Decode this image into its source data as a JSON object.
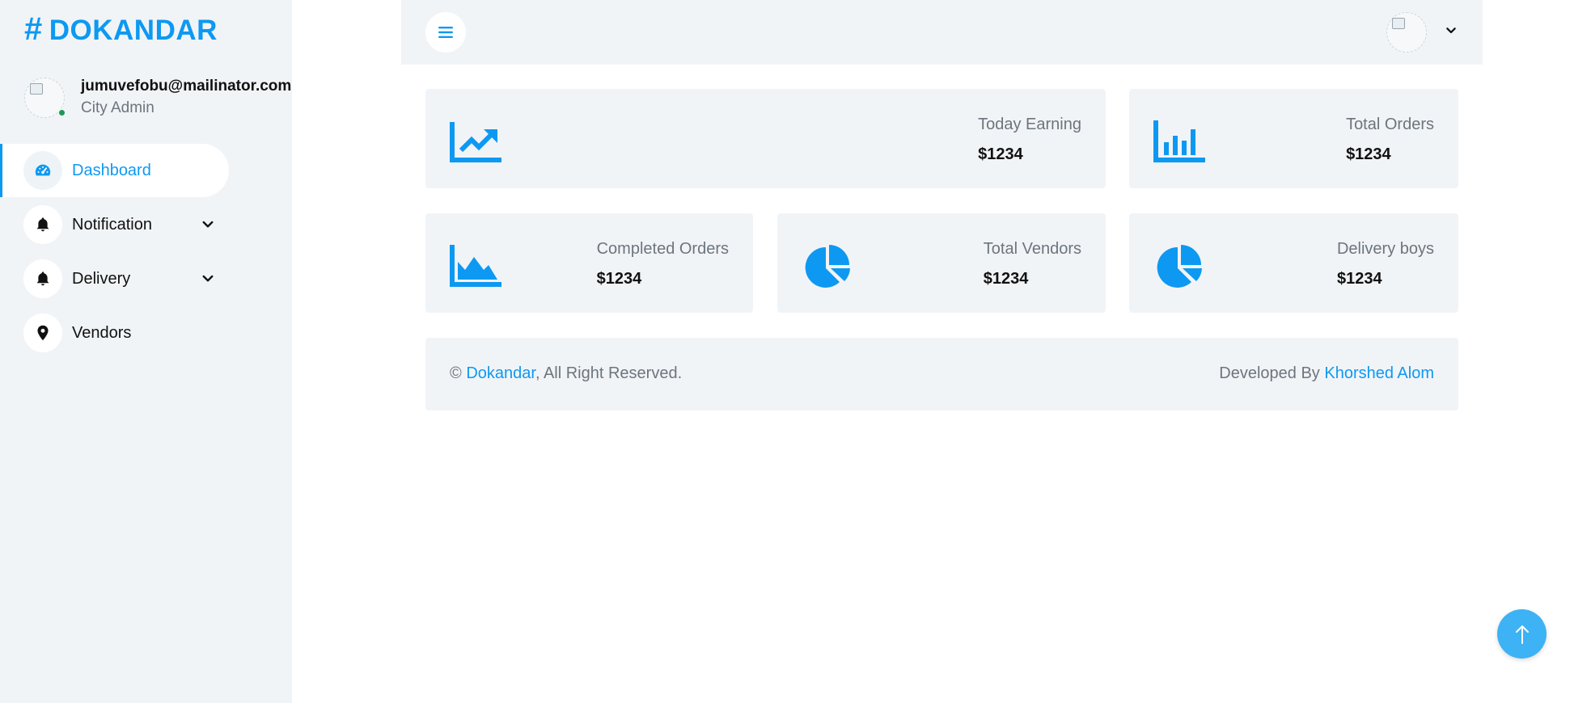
{
  "brand": {
    "hash": "#",
    "name": "DOKANDAR"
  },
  "user": {
    "email": "jumuvefobu@mailinator.com",
    "role": "City Admin"
  },
  "nav": [
    {
      "label": "Dashboard",
      "icon": "gauge-icon",
      "active": true
    },
    {
      "label": "Notification",
      "icon": "bell-icon",
      "has_submenu": true
    },
    {
      "label": "Delivery",
      "icon": "bell-icon",
      "has_submenu": true
    },
    {
      "label": "Vendors",
      "icon": "map-pin-icon"
    }
  ],
  "cards": [
    {
      "label": "Today Earning",
      "value": "$1234",
      "icon": "chart-line-icon"
    },
    {
      "label": "Total Orders",
      "value": "$1234",
      "icon": "chart-bar-icon"
    },
    {
      "label": "Completed Orders",
      "value": "$1234",
      "icon": "chart-area-icon"
    },
    {
      "label": "Total Vendors",
      "value": "$1234",
      "icon": "chart-pie-icon"
    },
    {
      "label": "Delivery boys",
      "value": "$1234",
      "icon": "chart-pie-icon"
    }
  ],
  "footer": {
    "copyright_symbol": "©",
    "site_link": "Dokandar",
    "rights": ", All Right Reserved.",
    "developed_by": "Developed By",
    "developer_link": "Khorshed Alom"
  },
  "colors": {
    "accent": "#0d99f2",
    "panel": "#f1f4f7",
    "muted": "#6c757d",
    "online": "#1a9a55",
    "scroll_button": "#3db2f5"
  }
}
